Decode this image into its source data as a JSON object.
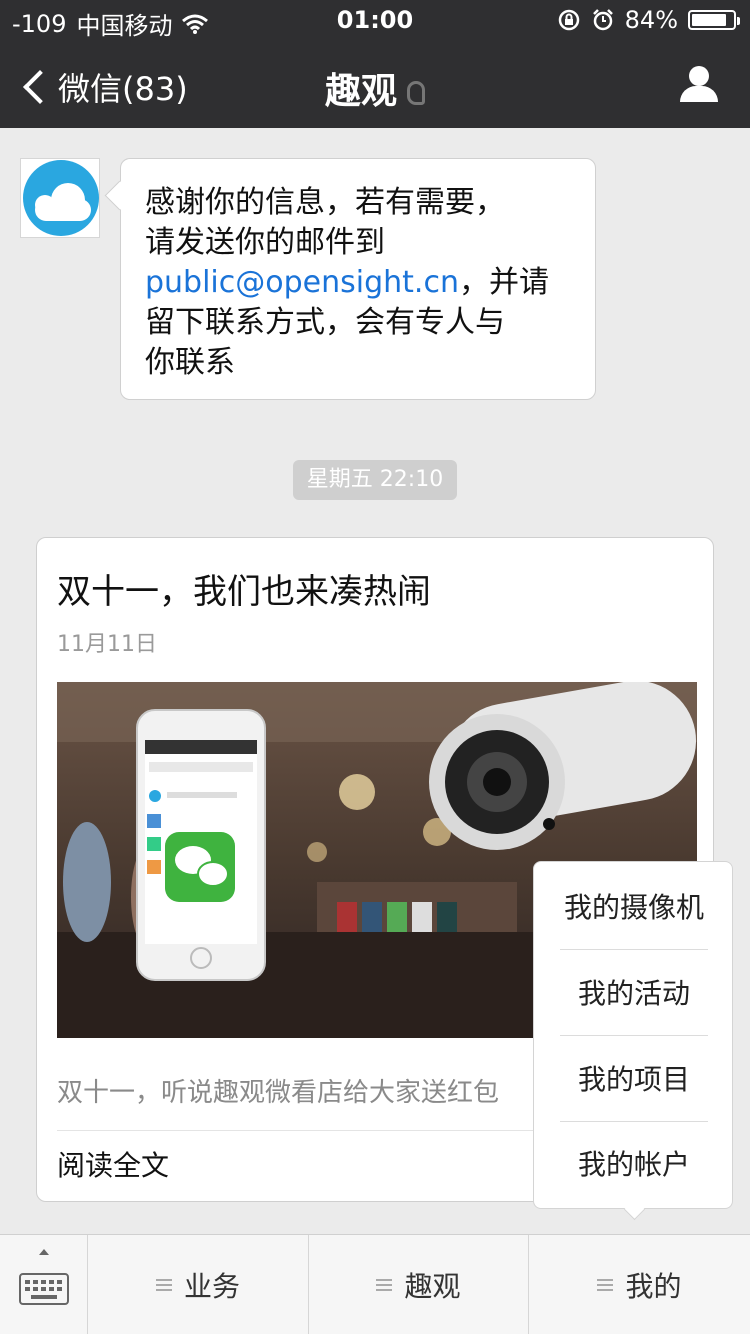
{
  "status_bar": {
    "signal": "-109",
    "carrier": "中国移动",
    "time": "01:00",
    "battery": "84%",
    "battery_level": 0.84
  },
  "navbar": {
    "back_label": "微信(83)",
    "title": "趣观",
    "icons": [
      "back-chevron-icon",
      "ear-icon",
      "person-icon"
    ]
  },
  "messages": {
    "reply_part1": "感谢你的信息，若有需要，",
    "reply_part2": "请发送你的邮件到",
    "reply_email": "public@opensight.cn",
    "reply_part3": "，并请",
    "reply_part4": "留下联系方式，会有专人与",
    "reply_part5": "你联系",
    "timestamp": "星期五 22:10"
  },
  "article": {
    "title": "双十一，我们也来凑热闹",
    "date": "11月11日",
    "summary": "双十一，听说趣观微看店给大家送红包",
    "read_more": "阅读全文"
  },
  "popup_menu": {
    "items": [
      "我的摄像机",
      "我的活动",
      "我的项目",
      "我的帐户"
    ]
  },
  "bottom_menu": {
    "items": [
      "业务",
      "趣观",
      "我的"
    ]
  },
  "colors": {
    "bar_bg": "#2f2f31",
    "page_bg": "#ebebeb",
    "link": "#1a73d8",
    "avatar_blue": "#2aa7e0"
  }
}
